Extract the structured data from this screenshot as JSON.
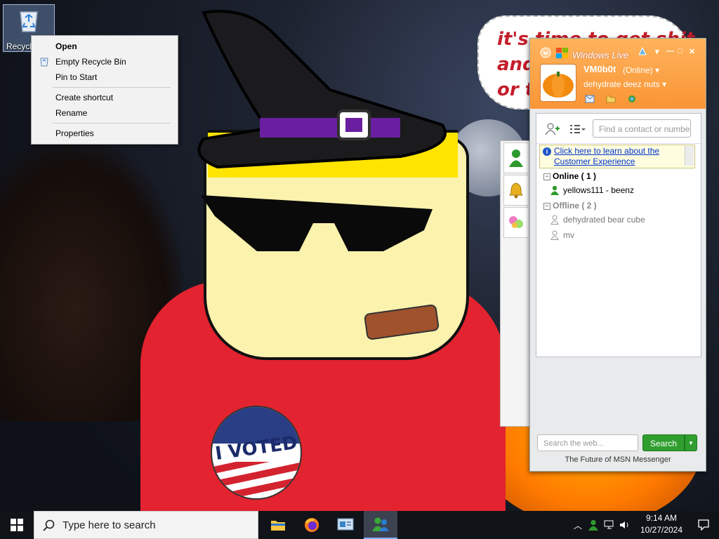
{
  "wallpaper": {
    "bubble_lines": [
      "it's time to get shit",
      "and",
      "or t"
    ],
    "badge_text": "I VOTED"
  },
  "desktop": {
    "icons": [
      {
        "label": "Recycle Bin",
        "icon": "recycle-bin-icon"
      }
    ]
  },
  "context_menu": {
    "items": [
      {
        "label": "Open",
        "bold": true
      },
      {
        "label": "Empty Recycle Bin",
        "icon": "recycle-bin-icon"
      },
      {
        "label": "Pin to Start"
      },
      {
        "label": "Create shortcut"
      },
      {
        "label": "Rename"
      },
      {
        "label": "Properties"
      }
    ]
  },
  "messenger": {
    "title": "Windows Live Messenger",
    "username": "VM0b0t",
    "status": "(Online)",
    "personal_message": "dehydrate deez nuts",
    "find_placeholder": "Find a contact or number",
    "notice_lines": [
      "Click here to learn about the",
      "Customer Experience"
    ],
    "groups": [
      {
        "label": "Online ( 1 )",
        "contacts": [
          "yellows111 - beenz"
        ]
      },
      {
        "label": "Offline ( 2 )",
        "contacts": [
          "dehydrated bear cube",
          "mv"
        ]
      }
    ],
    "web_search_placeholder": "Search the web...",
    "search_button": "Search",
    "footer": "The Future of MSN Messenger",
    "colors": {
      "header": "#f99535",
      "search_button": "#2f9e2f",
      "link": "#0033cc"
    }
  },
  "taskbar": {
    "search_placeholder": "Type here to search",
    "apps": [
      "file-explorer-icon",
      "firefox-icon",
      "control-panel-icon",
      "messenger-icon"
    ],
    "time": "9:14 AM",
    "date": "10/27/2024"
  }
}
